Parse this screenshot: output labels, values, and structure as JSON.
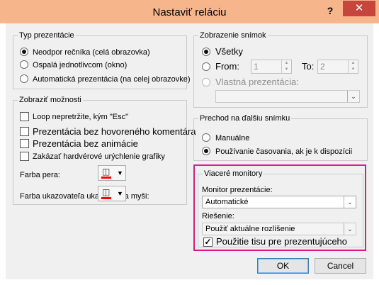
{
  "window": {
    "title": "Nastaviť reláciu",
    "help_icon": "?",
    "close_icon": "✕"
  },
  "presentation_type": {
    "legend": "Typ prezentácie",
    "options": [
      {
        "label": "Neodpor rečníka (celá obrazovka)",
        "selected": true
      },
      {
        "label": "Ospalá jednotlivcom (okno)",
        "selected": false
      },
      {
        "label": "Automatická prezentácia (na celej obrazovke)",
        "selected": false
      }
    ]
  },
  "show_slides": {
    "legend": "Zobrazenie snímok",
    "all_label": "Všetky",
    "from_label": "From:",
    "from_value": "1",
    "to_label": "To:",
    "to_value": "2",
    "custom_label": "Vlastná prezentácia:",
    "custom_value": ""
  },
  "show_options": {
    "legend": "Zobraziť možnosti",
    "checks": [
      {
        "label": "Loop nepretržite, kým \"Esc\"",
        "checked": false
      },
      {
        "label": "Prezentácia bez hovoreného komentára",
        "checked": false
      },
      {
        "label": "Prezentácia bez animácie",
        "checked": false
      },
      {
        "label": "Zakázať hardvérové urýchlenie grafiky",
        "checked": false
      }
    ],
    "pen_color_label": "Farba pera:",
    "pointer_color_label": "Farba ukazovateľa ukazovateľa myši:",
    "color": "#ff0000"
  },
  "advance_slides": {
    "legend": "Prechod na ďalšiu snímku",
    "manual_label": "Manuálne",
    "timings_label": "Používanie časovania, ak je k dispozícii"
  },
  "monitors": {
    "legend": "Viaceré monitory",
    "monitor_label": "Monitor prezentácie:",
    "monitor_value": "Automatické",
    "resolution_label": "Riešenie:",
    "resolution_value": "Použiť aktuálne rozlíšenie",
    "presenter_view_label": "Použitie tisu pre prezentujúceho",
    "presenter_view_checked": true
  },
  "buttons": {
    "ok": "OK",
    "cancel": "Cancel"
  },
  "colors": {
    "titlebar": "#f6b58a",
    "close": "#c7453c",
    "highlight": "#e0188a"
  }
}
